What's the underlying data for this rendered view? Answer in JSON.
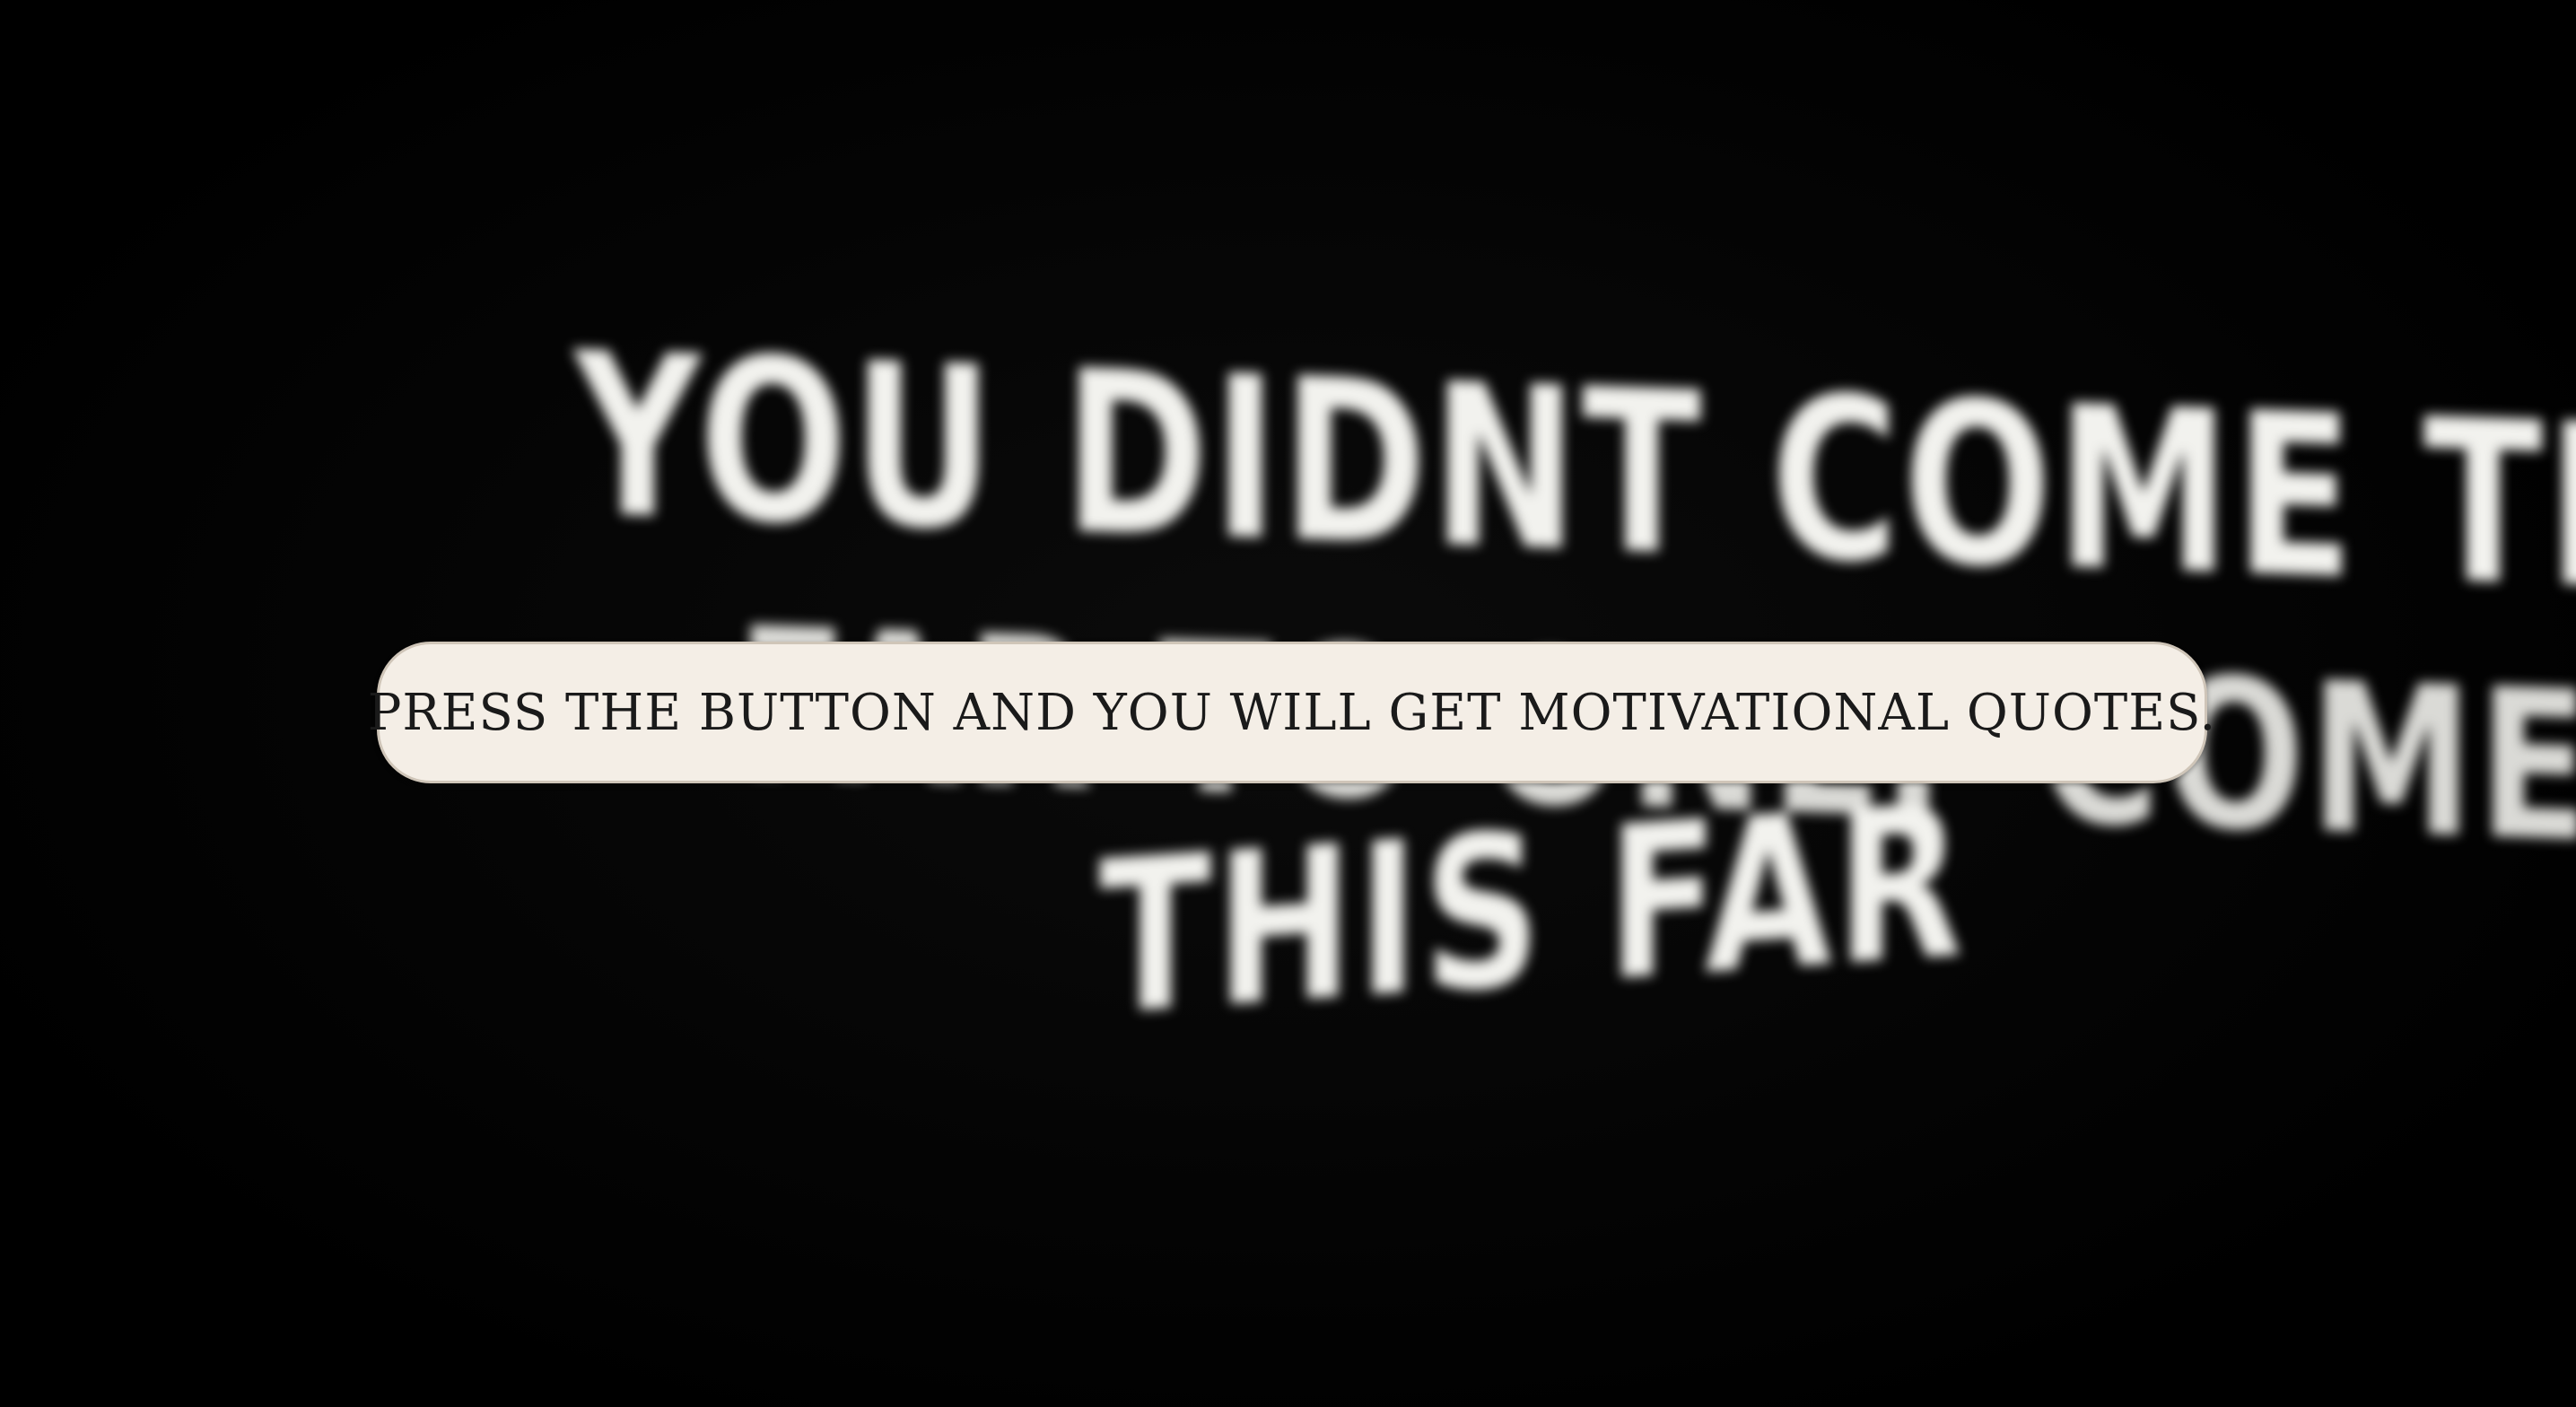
{
  "background": {
    "board_lines": [
      "YOU DIDNT COME THIS",
      "FAR TO ONLY COME",
      "THIS FAR"
    ]
  },
  "button": {
    "label": "PRESS THE BUTTON AND YOU WILL GET MOTIVATIONAL QUOTES."
  },
  "colors": {
    "background": "#000000",
    "board_text": "#f2f2ee",
    "button_fill": "#f4eee6",
    "button_border": "#cfc5b8",
    "button_text": "#1a1a1a"
  }
}
